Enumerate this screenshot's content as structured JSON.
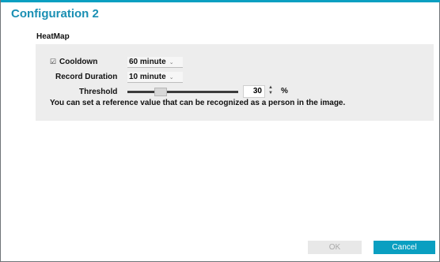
{
  "dialog": {
    "title": "Configuration 2",
    "section": "HeatMap",
    "cooldown": {
      "checked": true,
      "check_glyph": "☑",
      "label": "Cooldown",
      "value": "60 minute"
    },
    "record_duration": {
      "label": "Record Duration",
      "value": "10 minute"
    },
    "threshold": {
      "label": "Threshold",
      "value": "30",
      "unit": "%",
      "level_percent": 30
    },
    "hint": "You can set a reference value that can be recognized as a person in the image.",
    "buttons": {
      "ok": "OK",
      "cancel": "Cancel"
    },
    "icons": {
      "dropdown": "chevron-down-icon",
      "spinner": "spin-up-down-icon"
    },
    "colors": {
      "accent": "#0a9fc1",
      "title": "#1a8fb3"
    }
  }
}
